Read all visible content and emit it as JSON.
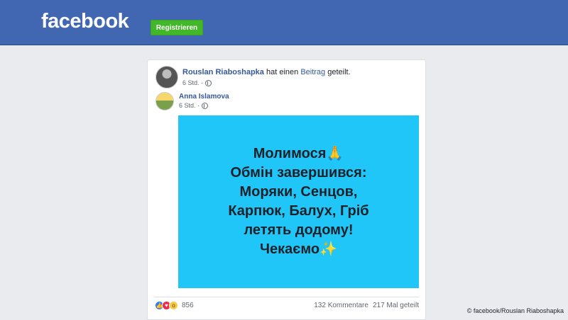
{
  "header": {
    "logo": "facebook",
    "register_label": "Registrieren"
  },
  "post": {
    "author": "Rouslan Riaboshapka",
    "action_prefix": "hat einen",
    "action_link": "Beitrag",
    "action_suffix": "geteilt.",
    "time": "6 Std. ·",
    "shared": {
      "author": "Anna Islamova",
      "time": "6 Std. ·"
    },
    "image_text": [
      "Молимося🙏",
      "Обмін завершився:",
      "Моряки, Сенцов,",
      "Карпюк, Балух, Гріб",
      "летять додому!",
      "Чекаємо✨"
    ],
    "image_background": "#21c6f8",
    "reactions": {
      "icons": [
        "like-icon",
        "love-icon",
        "wow-icon"
      ],
      "count": "856"
    },
    "comments": "132 Kommentare",
    "shares": "217 Mal geteilt"
  },
  "colors": {
    "header_blue": "#4267b2",
    "register_green": "#42b72a",
    "link_blue": "#365899"
  },
  "credit": "© facebook/Rouslan Riaboshapka"
}
